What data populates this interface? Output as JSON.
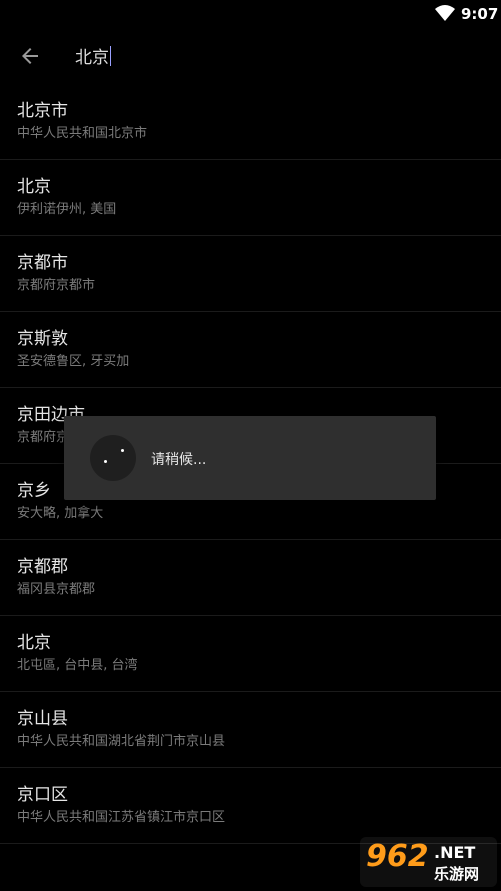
{
  "status_bar": {
    "time": "9:07",
    "wifi_icon": "wifi-icon"
  },
  "search": {
    "back_icon": "arrow-left-icon",
    "query": "北京"
  },
  "results": [
    {
      "name": "北京市",
      "desc": "中华人民共和国北京市"
    },
    {
      "name": "北京",
      "desc": "伊利诺伊州, 美国"
    },
    {
      "name": "京都市",
      "desc": "京都府京都市"
    },
    {
      "name": "京斯敦",
      "desc": "圣安德鲁区, 牙买加"
    },
    {
      "name": "京田边市",
      "desc": "京都府京田边市"
    },
    {
      "name": "京乡",
      "desc": "安大略, 加拿大"
    },
    {
      "name": "京都郡",
      "desc": "福冈县京都郡"
    },
    {
      "name": "北京",
      "desc": "北屯區, 台中县, 台湾"
    },
    {
      "name": "京山县",
      "desc": "中华人民共和国湖北省荆门市京山县"
    },
    {
      "name": "京口区",
      "desc": "中华人民共和国江苏省镇江市京口区"
    }
  ],
  "dialog": {
    "message": "请稍候..."
  },
  "watermark": {
    "logo": "962",
    "net": ".NET",
    "sub": "乐游网"
  }
}
